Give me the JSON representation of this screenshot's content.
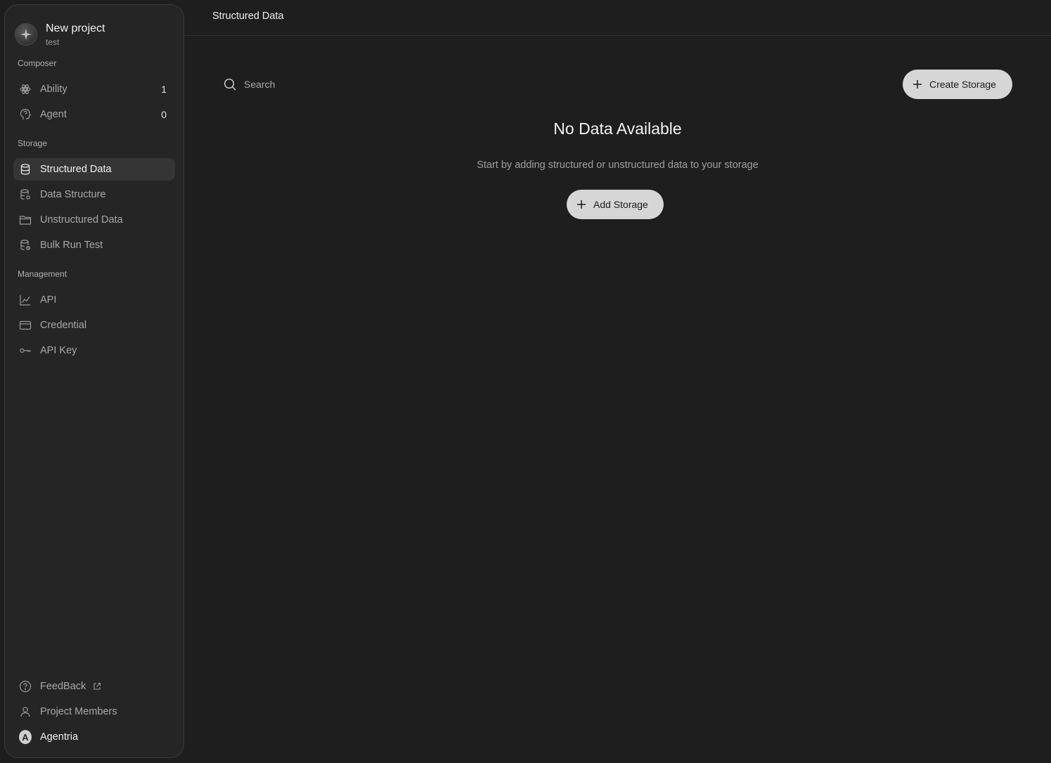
{
  "project": {
    "name": "New project",
    "subtitle": "test"
  },
  "sidebar": {
    "composer_label": "Composer",
    "composer_items": [
      {
        "label": "Ability",
        "count": "1",
        "icon": "ability-icon"
      },
      {
        "label": "Agent",
        "count": "0",
        "icon": "agent-icon"
      }
    ],
    "storage_label": "Storage",
    "storage_items": [
      {
        "label": "Structured Data",
        "icon": "database-icon",
        "active": true
      },
      {
        "label": "Data Structure",
        "icon": "database-settings-icon"
      },
      {
        "label": "Unstructured Data",
        "icon": "folder-icon"
      },
      {
        "label": "Bulk Run Test",
        "icon": "database-run-icon"
      }
    ],
    "management_label": "Management",
    "management_items": [
      {
        "label": "API",
        "icon": "chart-icon"
      },
      {
        "label": "Credential",
        "icon": "card-icon"
      },
      {
        "label": "API Key",
        "icon": "key-icon"
      }
    ],
    "footer_items": [
      {
        "label": "FeedBack",
        "icon": "help-icon",
        "external": true
      },
      {
        "label": "Project Members",
        "icon": "user-icon"
      },
      {
        "label": "Agentria",
        "icon": "avatar",
        "avatar_letter": "A"
      }
    ]
  },
  "header": {
    "title": "Structured Data"
  },
  "main": {
    "search_placeholder": "Search",
    "create_button": "Create Storage",
    "empty_title": "No Data Available",
    "empty_subtitle": "Start by adding structured or unstructured data to your storage",
    "add_button": "Add Storage"
  },
  "colors": {
    "background": "#1e1e1e",
    "sidebar": "#252525",
    "active_item": "#353535",
    "button": "#d6d6d6"
  }
}
